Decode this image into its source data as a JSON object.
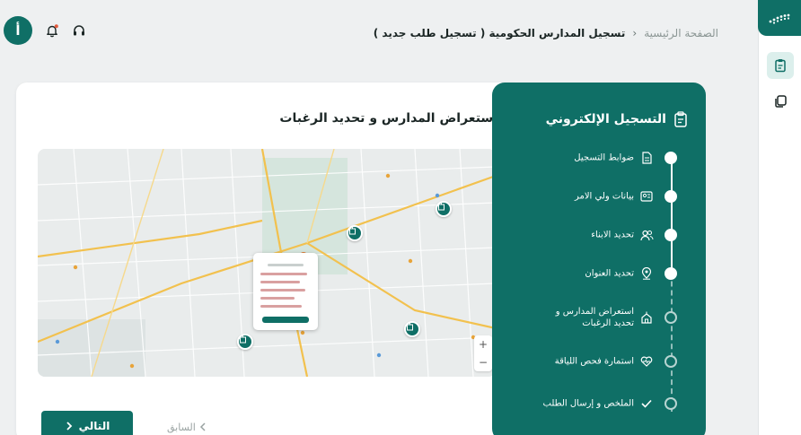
{
  "header": {
    "avatar_letter": "أ",
    "breadcrumb": {
      "home": "الصفحة الرئيسية",
      "current": "تسجيل المدارس الحكومية ( تسجيل طلب جديد )"
    }
  },
  "stepper": {
    "title": "التسجيل الإلكتروني",
    "steps": [
      {
        "label": "ضوابط التسجيل",
        "status": "done",
        "icon": "document-icon"
      },
      {
        "label": "بيانات ولي الامر",
        "status": "done",
        "icon": "id-card-icon"
      },
      {
        "label": "تحديد الابناء",
        "status": "done",
        "icon": "users-icon"
      },
      {
        "label": "تحديد العنوان",
        "status": "done",
        "icon": "location-icon"
      },
      {
        "label": "استعراض المدارس و تحديد الرغبات",
        "status": "pending",
        "icon": "school-icon"
      },
      {
        "label": "استمارة فحص اللياقة",
        "status": "pending",
        "icon": "heart-pulse-icon"
      },
      {
        "label": "الملخص و إرسال الطلب",
        "status": "pending",
        "icon": "check-icon"
      }
    ]
  },
  "main": {
    "title": "استعراض المدارس و تحديد الرغبات",
    "next_label": "التالي",
    "prev_label": "السابق"
  },
  "map": {
    "zoom_in": "+",
    "zoom_out": "−"
  },
  "colors": {
    "primary": "#0f6f66",
    "road_major": "#f2c14e",
    "background": "#eef0f1"
  }
}
